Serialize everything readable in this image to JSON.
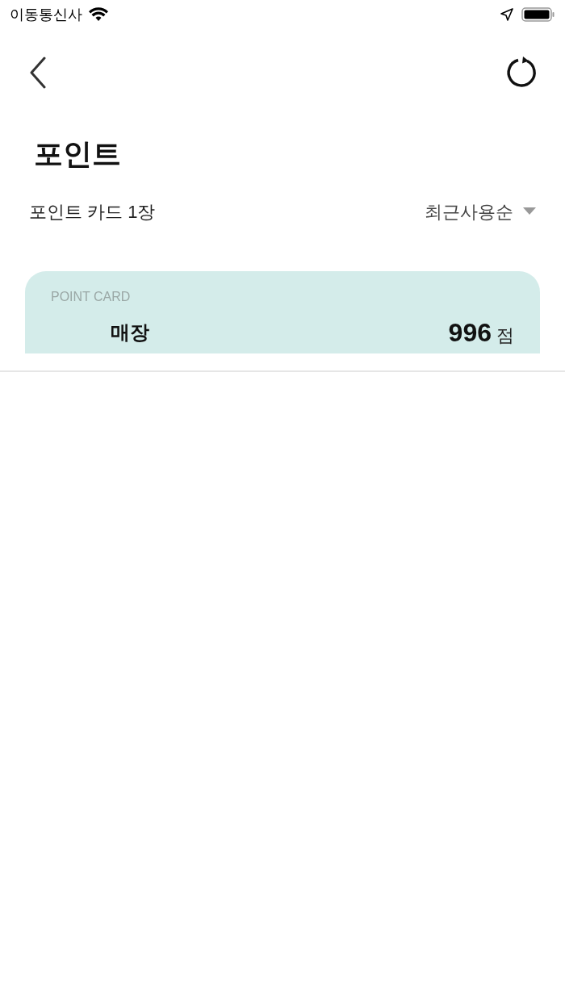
{
  "status_bar": {
    "carrier": "이동통신사"
  },
  "header": {
    "title": "포인트"
  },
  "summary": {
    "count_label": "포인트 카드 1장",
    "sort": "최근사용순"
  },
  "cards": [
    {
      "kind_label": "POINT CARD",
      "name": "매장",
      "points": "996",
      "unit": "점"
    }
  ]
}
